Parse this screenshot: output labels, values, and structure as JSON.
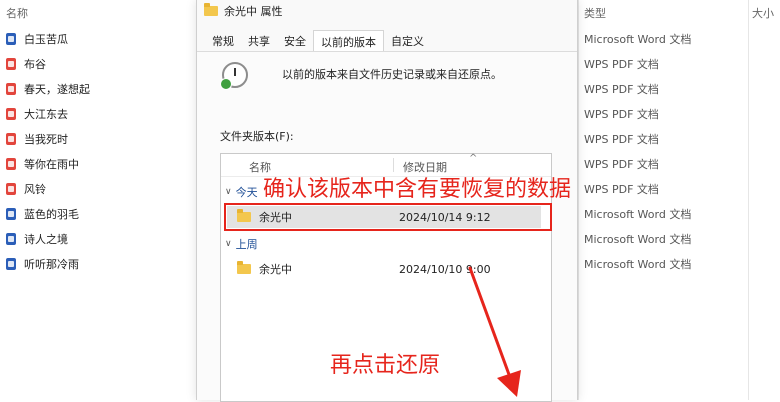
{
  "background": {
    "columns": {
      "name": "名称",
      "type": "类型",
      "size": "大小"
    },
    "files": [
      {
        "name": "白玉苦瓜",
        "kind": "word",
        "type": "Microsoft Word 文档"
      },
      {
        "name": "布谷",
        "kind": "pdf",
        "type": "WPS PDF 文档"
      },
      {
        "name": "春天，遂想起",
        "kind": "pdf",
        "type": "WPS PDF 文档"
      },
      {
        "name": "大江东去",
        "kind": "pdf",
        "type": "WPS PDF 文档"
      },
      {
        "name": "当我死时",
        "kind": "pdf",
        "type": "WPS PDF 文档"
      },
      {
        "name": "等你在雨中",
        "kind": "pdf",
        "type": "WPS PDF 文档"
      },
      {
        "name": "风铃",
        "kind": "pdf",
        "type": "WPS PDF 文档"
      },
      {
        "name": "蓝色的羽毛",
        "kind": "word",
        "type": "Microsoft Word 文档"
      },
      {
        "name": "诗人之境",
        "kind": "word",
        "type": "Microsoft Word 文档"
      },
      {
        "name": "听听那冷雨",
        "kind": "word",
        "type": "Microsoft Word 文档"
      }
    ]
  },
  "dialog": {
    "title": "余光中 属性",
    "tabs": [
      "常规",
      "共享",
      "安全",
      "以前的版本",
      "自定义"
    ],
    "active_tab": 3,
    "description": "以前的版本来自文件历史记录或来自还原点。",
    "list_label": "文件夹版本(F):",
    "list_columns": {
      "name": "名称",
      "date": "修改日期"
    },
    "groups": [
      {
        "label": "今天",
        "items": [
          {
            "name": "余光中",
            "date": "2024/10/14 9:12",
            "selected": true
          }
        ]
      },
      {
        "label": "上周",
        "items": [
          {
            "name": "余光中",
            "date": "2024/10/10 9:00",
            "selected": false
          }
        ]
      }
    ]
  },
  "annotations": {
    "confirm": "确认该版本中含有要恢复的数据",
    "click_restore": "再点击还原",
    "color": "#e6251c"
  }
}
